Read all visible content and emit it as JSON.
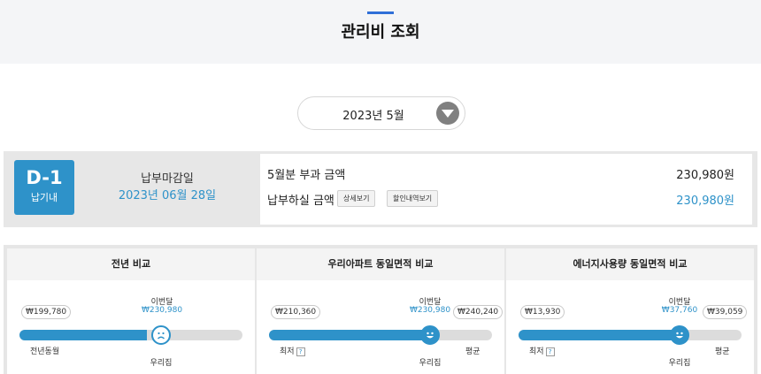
{
  "header": {
    "title": "관리비 조회"
  },
  "month_selector": {
    "selected": "2023년 5월"
  },
  "payment": {
    "dday": "D-1",
    "dday_sub": "납기내",
    "due_title": "납부마감일",
    "due_date": "2023년 06월 28일",
    "billed_label": "5월분 부과 금액",
    "billed_amount": "230,980원",
    "payable_label": "납부하실 금액",
    "payable_amount": "230,980원",
    "detail_button": "상세보기",
    "discount_button": "할인내역보기"
  },
  "comparisons": [
    {
      "title": "전년 비교",
      "left_value": "₩199,780",
      "current_label": "이번달",
      "current_value": "₩230,980",
      "left_label": "전년동월",
      "home_label": "우리집",
      "face": "sad",
      "fill_fraction": 0.57
    },
    {
      "title": "우리아파트 동일면적 비교",
      "left_value": "₩210,360",
      "current_label": "이번달",
      "current_value": "₩230,980",
      "right_value": "₩240,240",
      "left_label": "최저",
      "help_glyph": "?",
      "right_label": "평균",
      "home_label": "우리집",
      "face": "happy",
      "fill_fraction": 0.72
    },
    {
      "title": "에너지사용량 동일면적 비교",
      "left_value": "₩13,930",
      "current_label": "이번달",
      "current_value": "₩37,760",
      "right_value": "₩39,059",
      "left_label": "최저",
      "help_glyph": "?",
      "right_label": "평균",
      "home_label": "우리집",
      "face": "happy",
      "fill_fraction": 0.72
    }
  ],
  "colors": {
    "accent": "#2e92c9",
    "header_accent": "#2f6fd8",
    "arrow": "#808080"
  }
}
